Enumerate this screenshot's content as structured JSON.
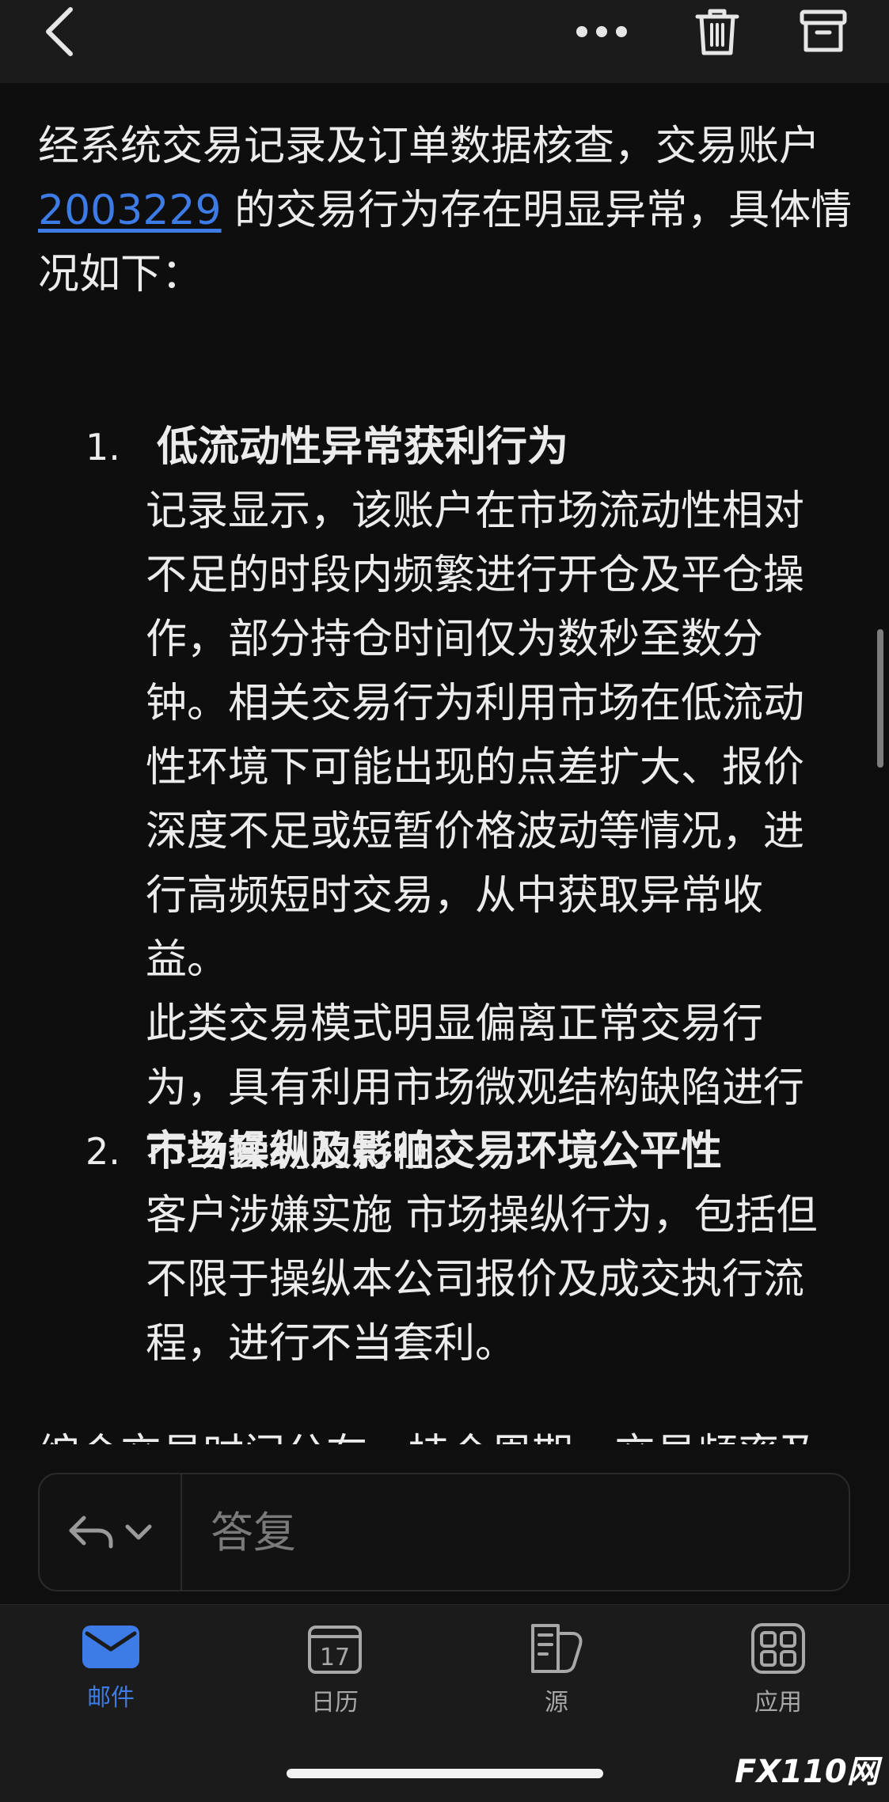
{
  "message": {
    "intro_prefix": "经系统交易记录及订单数据核查，交易账户",
    "account_id": "2003229",
    "intro_suffix": " 的交易行为存在明显异常，具体情况如下：",
    "items": [
      {
        "number": "1.",
        "title": "低流动性异常获利行为",
        "body": "记录显示，该账户在市场流动性相对\n不足的时段内频繁进行开仓及平仓操\n作，部分持仓时间仅为数秒至数分\n钟。相关交易行为利用市场在低流动\n性环境下可能出现的点差扩大、报价\n深度不足或短暂价格波动等情况，进\n行高频短时交易，从中获取异常收\n益。\n此类交易模式明显偏离正常交易行\n为，具有利用市场微观结构缺陷进行\n不当套利的特征。"
      },
      {
        "number": "2.",
        "title": "市场操纵及影响交易环境公平性",
        "body": "客户涉嫌实施 市场操纵行为，包括但\n不限于操纵本公司报价及成交执行流\n程，进行不当套利。"
      }
    ],
    "partial_line": "综合交易时间分布、持仓周期、交易频率及"
  },
  "reply": {
    "placeholder": "答复"
  },
  "tabs": [
    {
      "label": "邮件",
      "icon": "mail-icon",
      "active": true
    },
    {
      "label": "日历",
      "icon": "calendar-icon",
      "day": "17",
      "active": false
    },
    {
      "label": "源",
      "icon": "feeds-icon",
      "active": false
    },
    {
      "label": "应用",
      "icon": "apps-icon",
      "active": false
    }
  ],
  "watermark": "FX110网",
  "colors": {
    "accent": "#3d7be6",
    "background": "#0e0e0e",
    "bar": "#1b1b1b"
  }
}
